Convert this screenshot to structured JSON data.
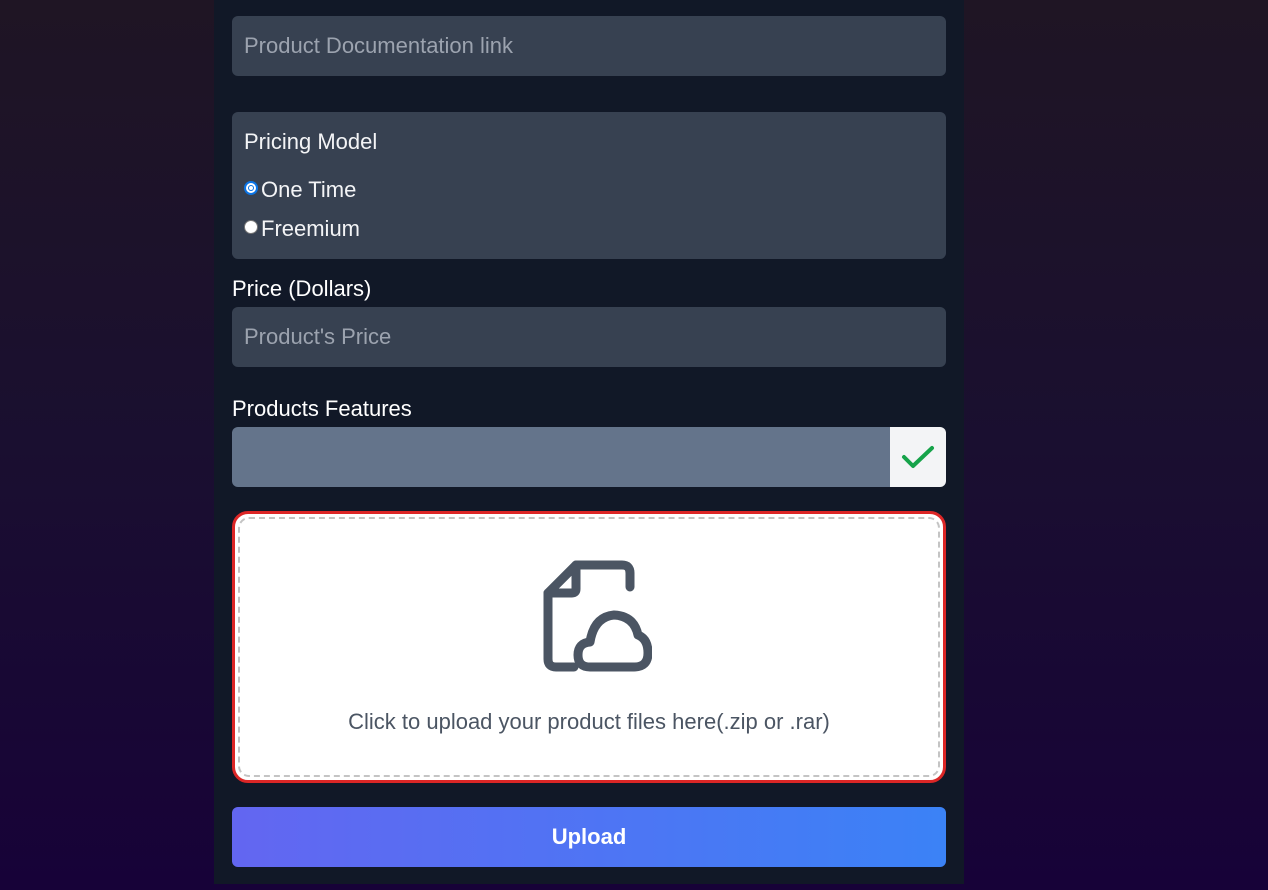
{
  "doc_link": {
    "placeholder": "Product Documentation link",
    "value": ""
  },
  "pricing": {
    "title": "Pricing Model",
    "options": [
      {
        "label": "One Time",
        "selected": true
      },
      {
        "label": "Freemium",
        "selected": false
      }
    ]
  },
  "price": {
    "label": "Price (Dollars)",
    "placeholder": "Product's Price",
    "value": ""
  },
  "features": {
    "label": "Products Features",
    "value": "",
    "add_icon": "checkmark-icon"
  },
  "upload_zone": {
    "icon": "file-cloud-icon",
    "text": "Click to upload your product files here(.zip or .rar)"
  },
  "submit": {
    "label": "Upload"
  },
  "colors": {
    "accent_start": "#6366f1",
    "accent_end": "#3b82f6",
    "error_border": "#dc2626",
    "check": "#16a34a"
  }
}
